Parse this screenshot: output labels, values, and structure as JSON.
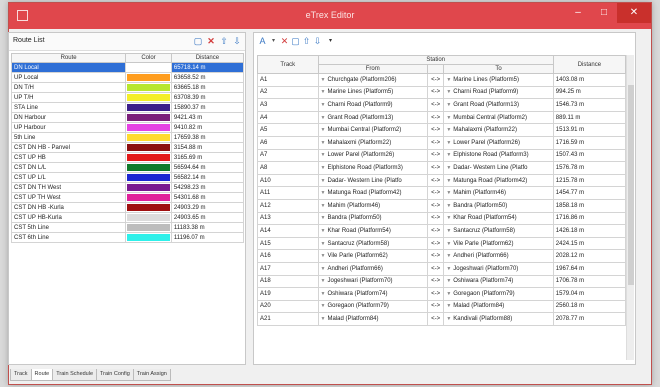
{
  "window": {
    "title": "eTrex Editor",
    "min": "–",
    "max": "□",
    "close": "✕"
  },
  "left": {
    "label": "Route List",
    "headers": {
      "route": "Route",
      "color": "Color",
      "distance": "Distance"
    },
    "rows": [
      {
        "route": "DN Local",
        "color": "#ffffff",
        "distance": "65718.14 m",
        "selected": true
      },
      {
        "route": "UP Local",
        "color": "#ff9d1e",
        "distance": "63658.52 m"
      },
      {
        "route": "DN T/H",
        "color": "#b8e62e",
        "distance": "63665.18 m"
      },
      {
        "route": "UP T/H",
        "color": "#f4ef29",
        "distance": "63708.39 m"
      },
      {
        "route": "STA Line",
        "color": "#3c1f8a",
        "distance": "15890.37 m"
      },
      {
        "route": "DN Harbour",
        "color": "#7b1f7a",
        "distance": "9421.43 m"
      },
      {
        "route": "UP Harbour",
        "color": "#e542e3",
        "distance": "9410.82 m"
      },
      {
        "route": "5th Line",
        "color": "#ffdb2e",
        "distance": "17659.38 m"
      },
      {
        "route": "CST DN HB - Panvel",
        "color": "#8c0f0f",
        "distance": "3154.88 m"
      },
      {
        "route": "CST UP HB",
        "color": "#e31919",
        "distance": "3165.69 m"
      },
      {
        "route": "CST DN L/L",
        "color": "#0f7a2a",
        "distance": "56594.64 m"
      },
      {
        "route": "CST UP L/L",
        "color": "#1c27d2",
        "distance": "56582.14 m"
      },
      {
        "route": "CST DN TH West",
        "color": "#7a1a90",
        "distance": "54298.23 m"
      },
      {
        "route": "CST UP TH West",
        "color": "#e0229a",
        "distance": "54301.68 m"
      },
      {
        "route": "CST DN HB -Kurla",
        "color": "#a01010",
        "distance": "24903.29 m"
      },
      {
        "route": "CST UP HB-Kurla",
        "color": "#dcdcdc",
        "distance": "24903.65 m"
      },
      {
        "route": "CST 5th Line",
        "color": "#bdbdbd",
        "distance": "11183.38 m"
      },
      {
        "route": "CST 6th Line",
        "color": "#2ef0ea",
        "distance": "11196.07 m"
      }
    ]
  },
  "right": {
    "headers": {
      "track": "Track",
      "station": "Station",
      "from": "From",
      "to": "To",
      "distance": "Distance"
    },
    "swap_label": "<->",
    "rows": [
      {
        "track": "A1",
        "from": "Churchgate (Platform206)",
        "to": "Marine Lines (Platform5)",
        "distance": "1403.08 m"
      },
      {
        "track": "A2",
        "from": "Marine Lines (Platform5)",
        "to": "Charni Road (Platform9)",
        "distance": "994.25 m"
      },
      {
        "track": "A3",
        "from": "Charni Road (Platform9)",
        "to": "Grant Road (Platform13)",
        "distance": "1546.73 m"
      },
      {
        "track": "A4",
        "from": "Grant Road (Platform13)",
        "to": "Mumbai Central (Platform2)",
        "distance": "889.11 m"
      },
      {
        "track": "A5",
        "from": "Mumbai Central (Platform2)",
        "to": "Mahalaxmi (Platform22)",
        "distance": "1513.91 m"
      },
      {
        "track": "A6",
        "from": "Mahalaxmi (Platform22)",
        "to": "Lower Parel (Platform26)",
        "distance": "1716.59 m"
      },
      {
        "track": "A7",
        "from": "Lower Parel (Platform26)",
        "to": "Elphistone Road (Platform3)",
        "distance": "1507.43 m"
      },
      {
        "track": "A8",
        "from": "Elphistone Road (Platform3)",
        "to": "Dadar- Western Line (Platfo",
        "distance": "1576.78 m"
      },
      {
        "track": "A10",
        "from": "Dadar- Western Line (Platfo",
        "to": "Matunga Road (Platform42)",
        "distance": "1215.78 m"
      },
      {
        "track": "A11",
        "from": "Matunga Road (Platform42)",
        "to": "Mahim (Platform46)",
        "distance": "1454.77 m"
      },
      {
        "track": "A12",
        "from": "Mahim (Platform46)",
        "to": "Bandra (Platform50)",
        "distance": "1858.18 m"
      },
      {
        "track": "A13",
        "from": "Bandra (Platform50)",
        "to": "Khar Road (Platform54)",
        "distance": "1716.86 m"
      },
      {
        "track": "A14",
        "from": "Khar Road (Platform54)",
        "to": "Santacruz (Platform58)",
        "distance": "1426.18 m"
      },
      {
        "track": "A15",
        "from": "Santacruz (Platform58)",
        "to": "Vile Parle (Platform62)",
        "distance": "2424.15 m"
      },
      {
        "track": "A16",
        "from": "Vile Parle (Platform62)",
        "to": "Andheri (Platform66)",
        "distance": "2028.12 m"
      },
      {
        "track": "A17",
        "from": "Andheri (Platform66)",
        "to": "Jogeshwari (Platform70)",
        "distance": "1967.64 m"
      },
      {
        "track": "A18",
        "from": "Jogeshwari (Platform70)",
        "to": "Oshiwara (Platform74)",
        "distance": "1706.78 m"
      },
      {
        "track": "A19",
        "from": "Oshiwara (Platform74)",
        "to": "Goregaon (Platform79)",
        "distance": "1579.04 m"
      },
      {
        "track": "A20",
        "from": "Goregaon (Platform79)",
        "to": "Malad (Platform84)",
        "distance": "2560.18 m"
      },
      {
        "track": "A21",
        "from": "Malad (Platform84)",
        "to": "Kandivali (Platform88)",
        "distance": "2078.77 m"
      }
    ]
  },
  "tabs": [
    {
      "label": "Track",
      "active": false
    },
    {
      "label": "Route",
      "active": true
    },
    {
      "label": "Train Schedule",
      "active": false
    },
    {
      "label": "Train Config",
      "active": false
    },
    {
      "label": "Train Assign",
      "active": false
    }
  ]
}
